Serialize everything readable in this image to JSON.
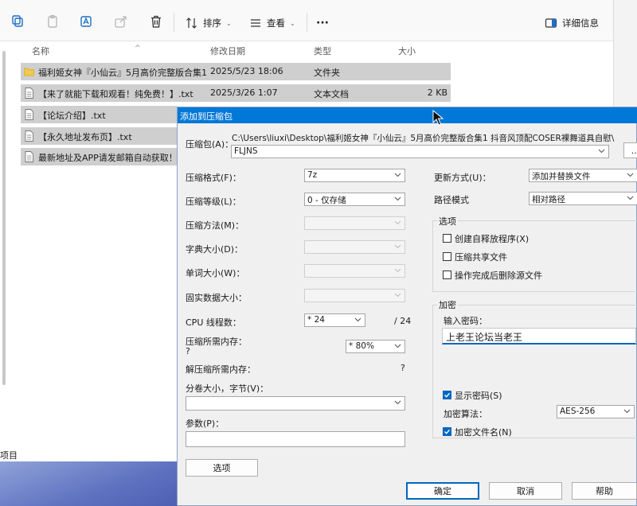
{
  "explorer": {
    "toolbar": {
      "sort_label": "排序",
      "view_label": "查看",
      "more_label": "···",
      "details_label": "详细信息"
    },
    "columns": {
      "name": "名称",
      "date": "修改日期",
      "type": "类型",
      "size": "大小"
    },
    "files": [
      {
        "name": "福利姬女神『小仙云』5月高价完整版合集1 抖音风顶配COSER裸舞道具自慰FLJNS",
        "date": "2025/5/23 18:06",
        "type": "文件夹",
        "size": "",
        "icon": "folder-icon"
      },
      {
        "name": "【来了就能下载和观看！纯免费！】.txt",
        "date": "2025/3/26 1:07",
        "type": "文本文档",
        "size": "2 KB",
        "icon": "text-file-icon"
      },
      {
        "name": "【论坛介绍】.txt",
        "date": "",
        "type": "",
        "size": "",
        "icon": "text-file-icon"
      },
      {
        "name": "【永久地址发布页】.txt",
        "date": "",
        "type": "",
        "size": "",
        "icon": "text-file-icon"
      },
      {
        "name": "最新地址及APP请发邮箱自动获取！",
        "date": "",
        "type": "",
        "size": "",
        "icon": "text-file-icon"
      }
    ],
    "status_text": "项目"
  },
  "dialog": {
    "title": "添加到压缩包",
    "archive_label": "压缩包(A)：",
    "archive_path_line1": "C:\\Users\\liuxi\\Desktop\\福利姬女神『小仙云』5月高价完整版合集1 抖音风顶配COSER裸舞道具自慰\\",
    "archive_path_line2": "FLJNS",
    "browse_label": "...",
    "format_label": "压缩格式(F)：",
    "format_value": "7z",
    "level_label": "压缩等级(L)：",
    "level_value": "0 - 仅存储",
    "method_label": "压缩方法(M)：",
    "dict_label": "字典大小(D)：",
    "word_label": "单词大小(W)：",
    "solid_label": "固实数据大小：",
    "cpu_label": "CPU 线程数：",
    "cpu_value": "* 24",
    "cpu_total": "/ 24",
    "mem_compress_label": "压缩所需内存：",
    "mem_compress_value": "?",
    "mem_percent_value": "* 80%",
    "mem_decompress_label": "解压缩所需内存：",
    "mem_decompress_value": "?",
    "split_label": "分卷大小，字节(V)：",
    "split_value": "",
    "params_label": "参数(P)：",
    "params_value": "",
    "options_button": "选项",
    "update_label": "更新方式(U)：",
    "update_value": "添加并替换文件",
    "path_mode_label": "路径模式",
    "path_mode_value": "相对路径",
    "options_group": "选项",
    "opt_sfx": "创建自释放程序(X)",
    "opt_shared": "压缩共享文件",
    "opt_delete": "操作完成后删除源文件",
    "encrypt_group": "加密",
    "password_label": "输入密码：",
    "password_value": "上老王论坛当老王",
    "show_password": "显示密码(S)",
    "enc_method_label": "加密算法：",
    "enc_method_value": "AES-256",
    "encrypt_names": "加密文件名(N)",
    "ok_button": "确定",
    "cancel_button": "取消",
    "help_button": "帮助"
  },
  "colors": {
    "title_bar": "#0078d7",
    "row_selected": "#cfcfcf",
    "checkbox_on": "#0067c0",
    "folder": "#f2c94c"
  }
}
